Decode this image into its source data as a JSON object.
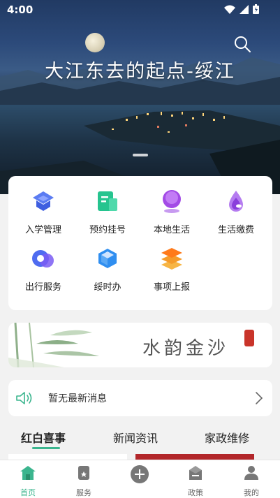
{
  "status_bar": {
    "time": "4:00"
  },
  "hero": {
    "title": "大江东去的起点-绥江"
  },
  "services": [
    {
      "label": "入学管理",
      "icon": "education-icon"
    },
    {
      "label": "预约挂号",
      "icon": "registration-icon"
    },
    {
      "label": "本地生活",
      "icon": "local-life-icon"
    },
    {
      "label": "生活缴费",
      "icon": "payment-icon"
    },
    {
      "label": "出行服务",
      "icon": "travel-icon"
    },
    {
      "label": "绥时办",
      "icon": "service-box-icon"
    },
    {
      "label": "事项上报",
      "icon": "report-icon"
    }
  ],
  "banner": {
    "text": "水韵金沙"
  },
  "notice": {
    "message": "暂无最新消息"
  },
  "tabs": [
    {
      "label": "红白喜事",
      "active": true
    },
    {
      "label": "新闻资讯",
      "active": false
    },
    {
      "label": "家政维修",
      "active": false
    }
  ],
  "bottom_nav": [
    {
      "label": "首页",
      "active": true
    },
    {
      "label": "服务",
      "active": false
    },
    {
      "label": "",
      "active": false
    },
    {
      "label": "政策",
      "active": false
    },
    {
      "label": "我的",
      "active": false
    }
  ],
  "colors": {
    "accent": "#3bb58e",
    "seal": "#c9342a"
  }
}
